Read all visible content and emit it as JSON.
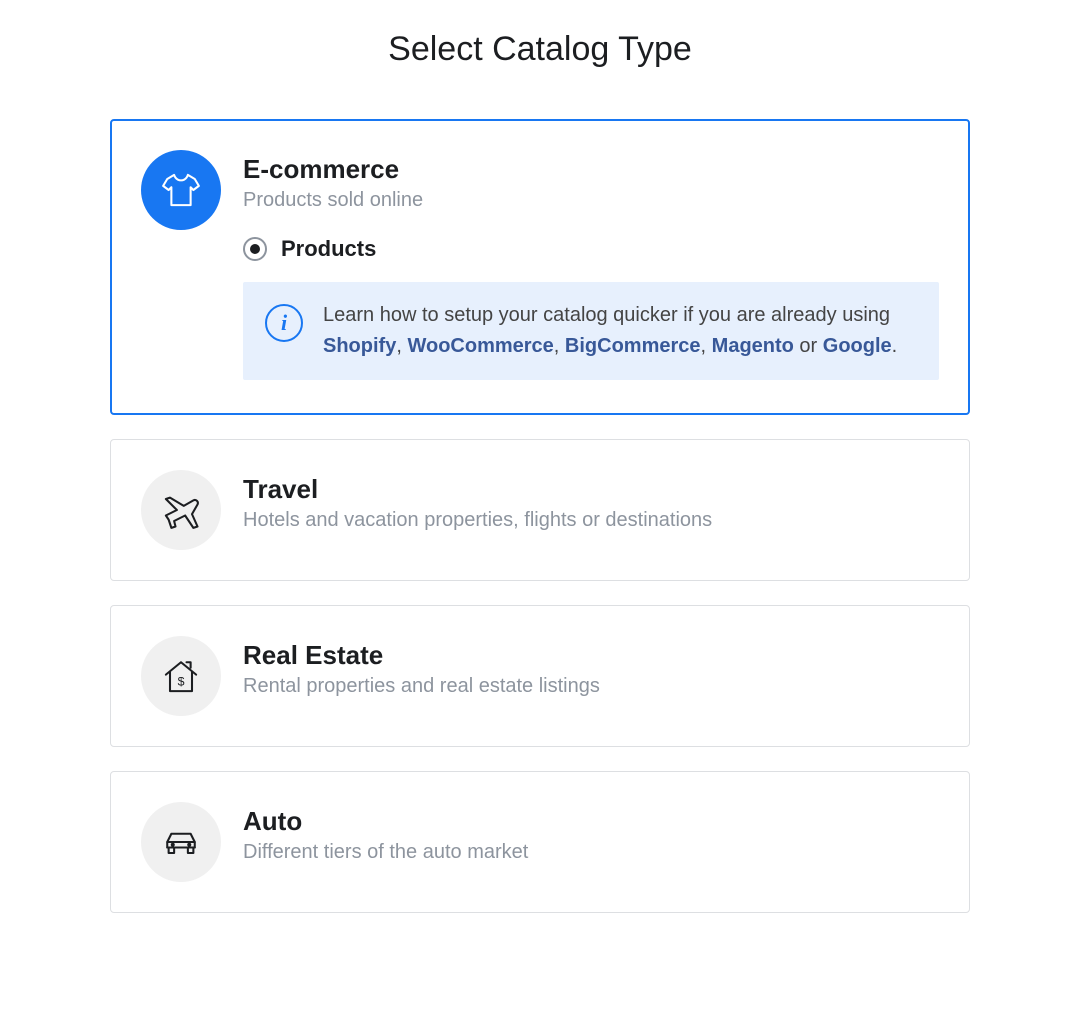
{
  "page_title": "Select Catalog Type",
  "options": [
    {
      "title": "E-commerce",
      "description": "Products sold online",
      "selected": true,
      "sub_option_label": "Products",
      "info": {
        "text_before": "Learn how to setup your catalog quicker if you are already using ",
        "links": [
          "Shopify",
          "WooCommerce",
          "BigCommerce",
          "Magento",
          "Google"
        ],
        "separator": ", ",
        "last_separator": " or ",
        "text_after": "."
      }
    },
    {
      "title": "Travel",
      "description": "Hotels and vacation properties, flights or destinations",
      "selected": false
    },
    {
      "title": "Real Estate",
      "description": "Rental properties and real estate listings",
      "selected": false
    },
    {
      "title": "Auto",
      "description": "Different tiers of the auto market",
      "selected": false
    }
  ]
}
